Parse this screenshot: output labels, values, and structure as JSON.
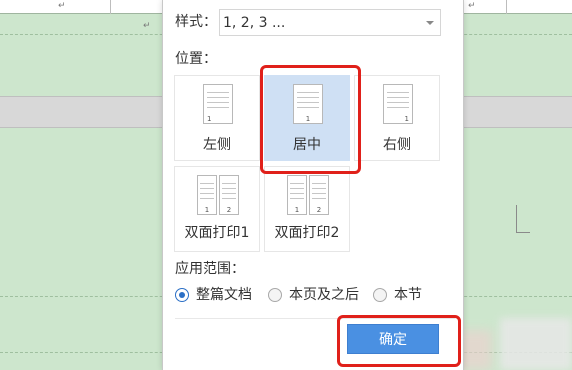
{
  "dialog": {
    "style_label": "样式：",
    "style_value": "1, 2, 3 ...",
    "position_label": "位置：",
    "positions": [
      {
        "label": "左侧",
        "num": "1"
      },
      {
        "label": "居中",
        "num": "1",
        "selected": true
      },
      {
        "label": "右侧",
        "num": "1"
      },
      {
        "label": "双面打印1",
        "nums": [
          "1",
          "2"
        ]
      },
      {
        "label": "双面打印2",
        "nums": [
          "1",
          "2"
        ]
      }
    ],
    "scope_label": "应用范围：",
    "scope_options": [
      {
        "label": "整篇文档",
        "checked": true
      },
      {
        "label": "本页及之后",
        "checked": false
      },
      {
        "label": "本节",
        "checked": false
      }
    ],
    "ok_label": "确定"
  },
  "colors": {
    "selected_tile": "#cfe0f4",
    "ok_button": "#4a90e2",
    "highlight": "#e0201a",
    "page_background": "#cde6cd"
  }
}
